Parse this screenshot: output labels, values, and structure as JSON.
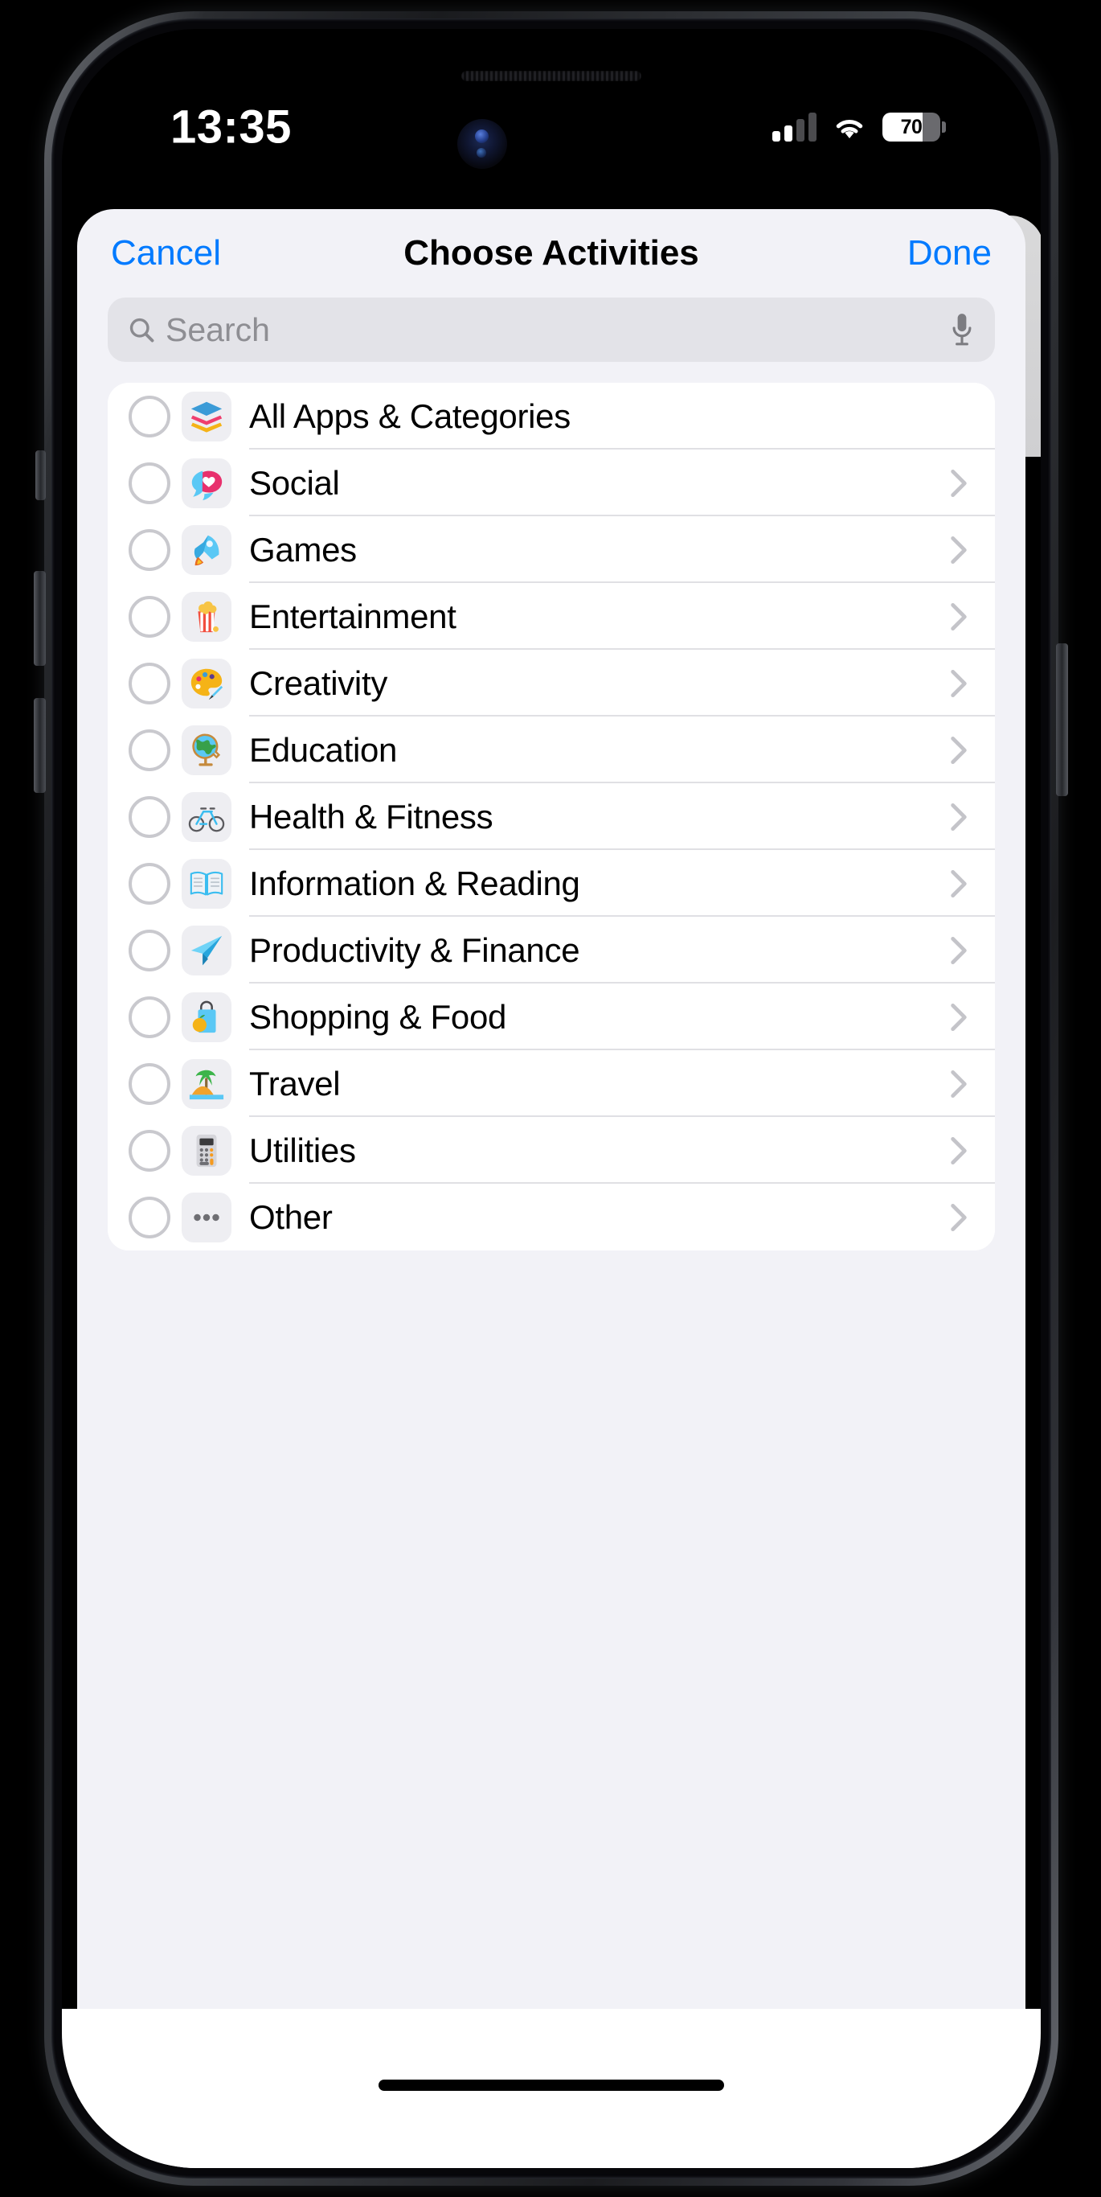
{
  "status_bar": {
    "time": "13:35",
    "battery_level": "70",
    "battery_percent": 70,
    "signal_icon": "cellular-bars-icon",
    "wifi_icon": "wifi-icon",
    "battery_icon": "battery-icon"
  },
  "navbar": {
    "cancel_label": "Cancel",
    "title": "Choose Activities",
    "done_label": "Done",
    "tint_color": "#007aff"
  },
  "search": {
    "placeholder": "Search",
    "value": "",
    "search_icon": "search-icon",
    "mic_icon": "microphone-icon"
  },
  "list": {
    "rows": [
      {
        "label": "All Apps & Categories",
        "icon": "layers-stack-icon",
        "checked": false,
        "has_chevron": false
      },
      {
        "label": "Social",
        "icon": "speech-bubble-heart-icon",
        "checked": false,
        "has_chevron": true
      },
      {
        "label": "Games",
        "icon": "rocket-icon",
        "checked": false,
        "has_chevron": true
      },
      {
        "label": "Entertainment",
        "icon": "popcorn-icon",
        "checked": false,
        "has_chevron": true
      },
      {
        "label": "Creativity",
        "icon": "paint-palette-icon",
        "checked": false,
        "has_chevron": true
      },
      {
        "label": "Education",
        "icon": "globe-icon",
        "checked": false,
        "has_chevron": true
      },
      {
        "label": "Health & Fitness",
        "icon": "bicycle-icon",
        "checked": false,
        "has_chevron": true
      },
      {
        "label": "Information & Reading",
        "icon": "open-book-icon",
        "checked": false,
        "has_chevron": true
      },
      {
        "label": "Productivity & Finance",
        "icon": "paper-plane-icon",
        "checked": false,
        "has_chevron": true
      },
      {
        "label": "Shopping & Food",
        "icon": "shopping-bag-icon",
        "checked": false,
        "has_chevron": true
      },
      {
        "label": "Travel",
        "icon": "desert-island-icon",
        "checked": false,
        "has_chevron": true
      },
      {
        "label": "Utilities",
        "icon": "calculator-icon",
        "checked": false,
        "has_chevron": true
      },
      {
        "label": "Other",
        "icon": "ellipsis-icon",
        "checked": false,
        "has_chevron": true
      }
    ]
  },
  "colors": {
    "accent": "#007aff",
    "sheet_background": "#f2f2f7",
    "card_background": "#ffffff",
    "separator": "#e0e0e4",
    "icon_tile": "#eeeef2",
    "search_field": "#e3e3e8",
    "placeholder_text": "#8e8e93"
  }
}
